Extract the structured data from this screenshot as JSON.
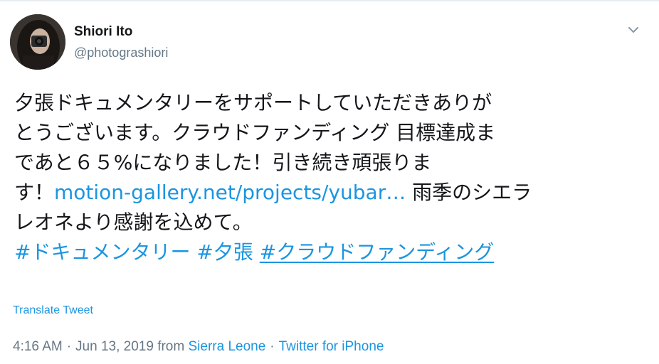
{
  "author": {
    "name": "Shiori Ito",
    "handle": "@photograshiori"
  },
  "tweet": {
    "line1": "夕張ドキュメンタリーをサポートしていただきありが",
    "line2": "とうございます。クラウドファンディング 目標達成ま",
    "line3": "であと６５%になりました！引き続き頑張りま",
    "line4_prefix": "す！",
    "link_text": "motion-gallery.net/projects/yubar…",
    "line4_suffix": " 雨季のシエラ",
    "line5": "レオネより感謝を込めて。",
    "hashtags": [
      "#ドキュメンタリー",
      "#夕張",
      "#クラウドファンディング"
    ]
  },
  "translate_label": "Translate Tweet",
  "meta": {
    "time": "4:16 AM",
    "date": "Jun 13, 2019",
    "from_label": "from",
    "location": "Sierra Leone",
    "separator": "·",
    "source": "Twitter for iPhone"
  },
  "colors": {
    "link": "#1b95e0",
    "secondary_text": "#657786",
    "primary_text": "#14171a"
  },
  "icons": {
    "caret": "chevron-down-icon",
    "avatar": "profile-photo"
  }
}
